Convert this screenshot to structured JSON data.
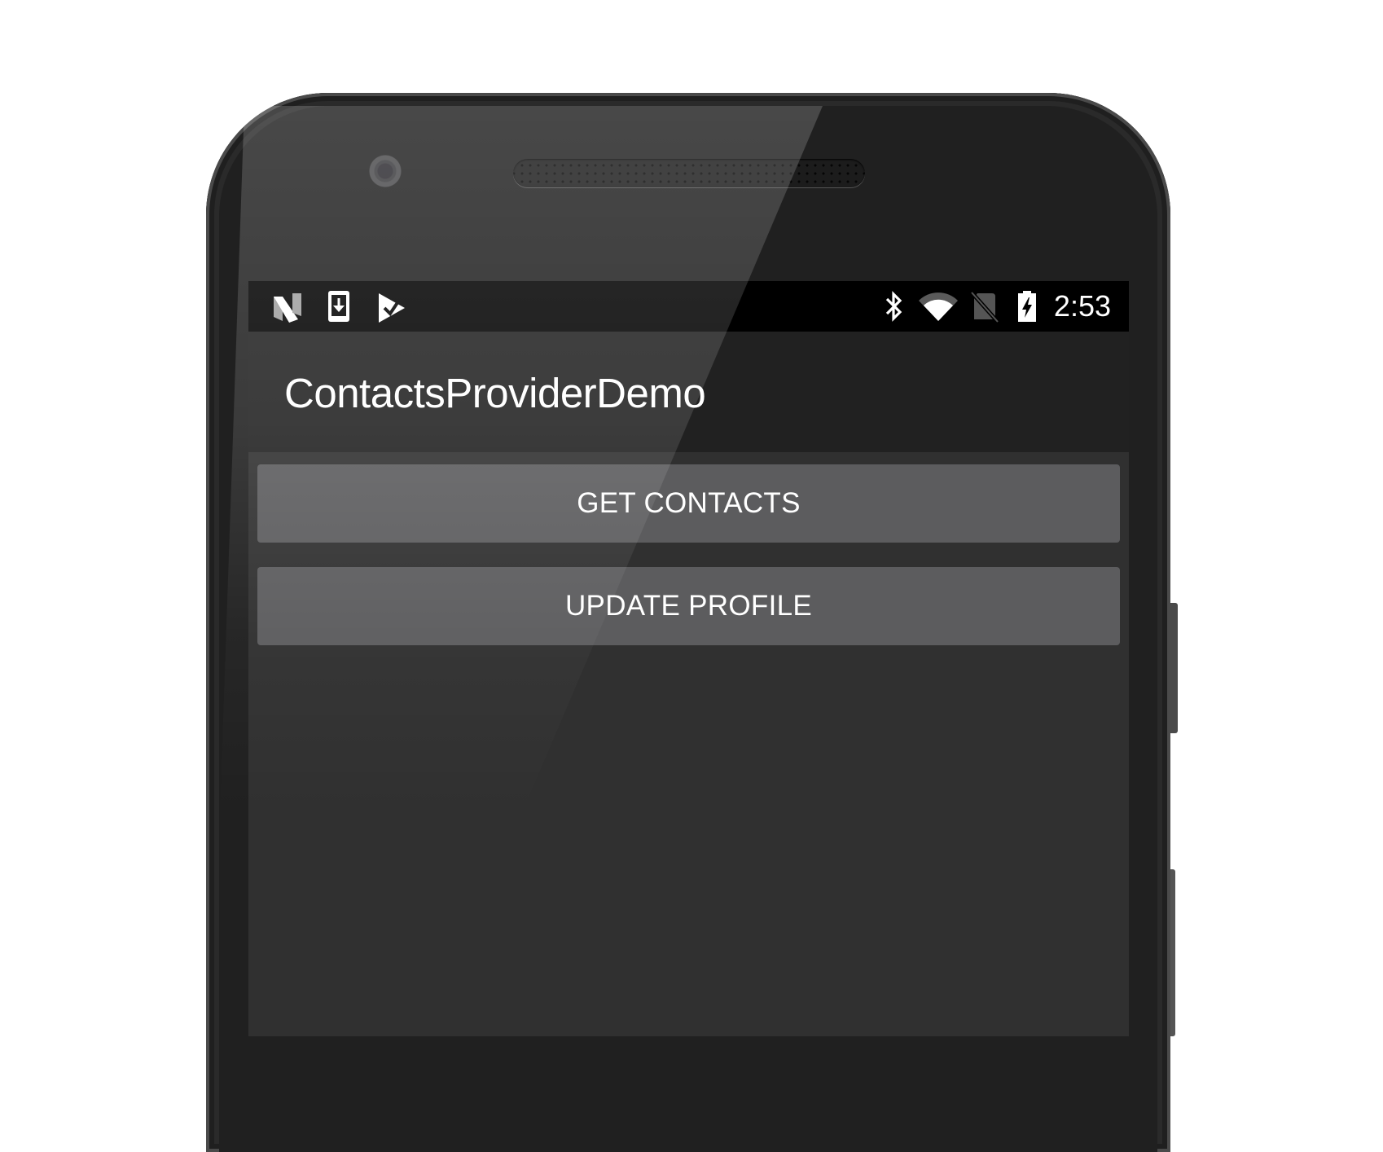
{
  "device": {
    "model": "Nexus-style Android phone"
  },
  "status_bar": {
    "left_icons": [
      "android-n-icon",
      "phone-download-icon",
      "task-check-icon"
    ],
    "right_icons": [
      "bluetooth-icon",
      "wifi-icon",
      "no-sim-icon",
      "battery-charging-icon"
    ],
    "time": "2:53"
  },
  "app_bar": {
    "title": "ContactsProviderDemo"
  },
  "main": {
    "buttons": [
      {
        "label": "GET CONTACTS"
      },
      {
        "label": "UPDATE PROFILE"
      }
    ]
  },
  "colors": {
    "status_bar": "#000000",
    "app_bar": "#212121",
    "background": "#303030",
    "button": "#5c5c5e",
    "text": "#ffffff"
  }
}
